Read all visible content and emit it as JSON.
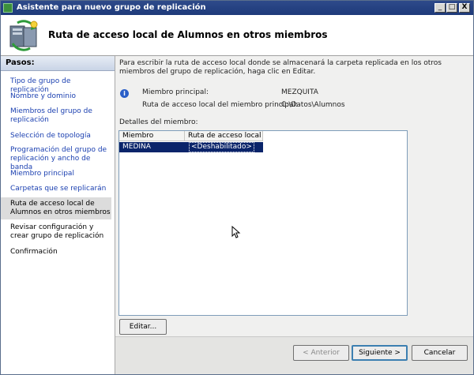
{
  "window": {
    "title": "Asistente para nuevo grupo de replicación",
    "controls": {
      "minimize": "_",
      "maximize": "□",
      "close": "X"
    }
  },
  "header": {
    "title": "Ruta de acceso local de Alumnos en otros miembros",
    "icon": "replication-wizard-icon"
  },
  "sidebar": {
    "heading": "Pasos:",
    "items": [
      {
        "label": "Tipo de grupo de replicación",
        "state": "link"
      },
      {
        "label": "Nombre y dominio",
        "state": "link"
      },
      {
        "label": "Miembros del grupo de replicación",
        "state": "link"
      },
      {
        "label": "Selección de topología",
        "state": "link"
      },
      {
        "label": "Programación del grupo de replicación y ancho de banda",
        "state": "link"
      },
      {
        "label": "Miembro principal",
        "state": "link"
      },
      {
        "label": "Carpetas que se replicarán",
        "state": "link"
      },
      {
        "label": "Ruta de acceso local de Alumnos en otros miembros",
        "state": "current"
      },
      {
        "label": "Revisar configuración y crear grupo de replicación",
        "state": "plain"
      },
      {
        "label": "Confirmación",
        "state": "plain"
      }
    ]
  },
  "main": {
    "intro": "Para escribir la ruta de acceso local donde se almacenará la carpeta replicada en los otros miembros del grupo de replicación, haga clic en Editar.",
    "primary_member_label": "Miembro principal:",
    "primary_member_value": "MEZQUITA",
    "primary_path_label": "Ruta de acceso local del miembro principal:",
    "primary_path_value": "C:\\Datos\\Alumnos",
    "details_label": "Detalles del miembro:",
    "table": {
      "columns": [
        "Miembro",
        "Ruta de acceso local"
      ],
      "rows": [
        {
          "member": "MEDINA",
          "path": "<Deshabilitado>",
          "selected": true
        }
      ]
    },
    "edit_button": "Editar..."
  },
  "footer": {
    "back": "< Anterior",
    "next": "Siguiente >",
    "cancel": "Cancelar"
  }
}
